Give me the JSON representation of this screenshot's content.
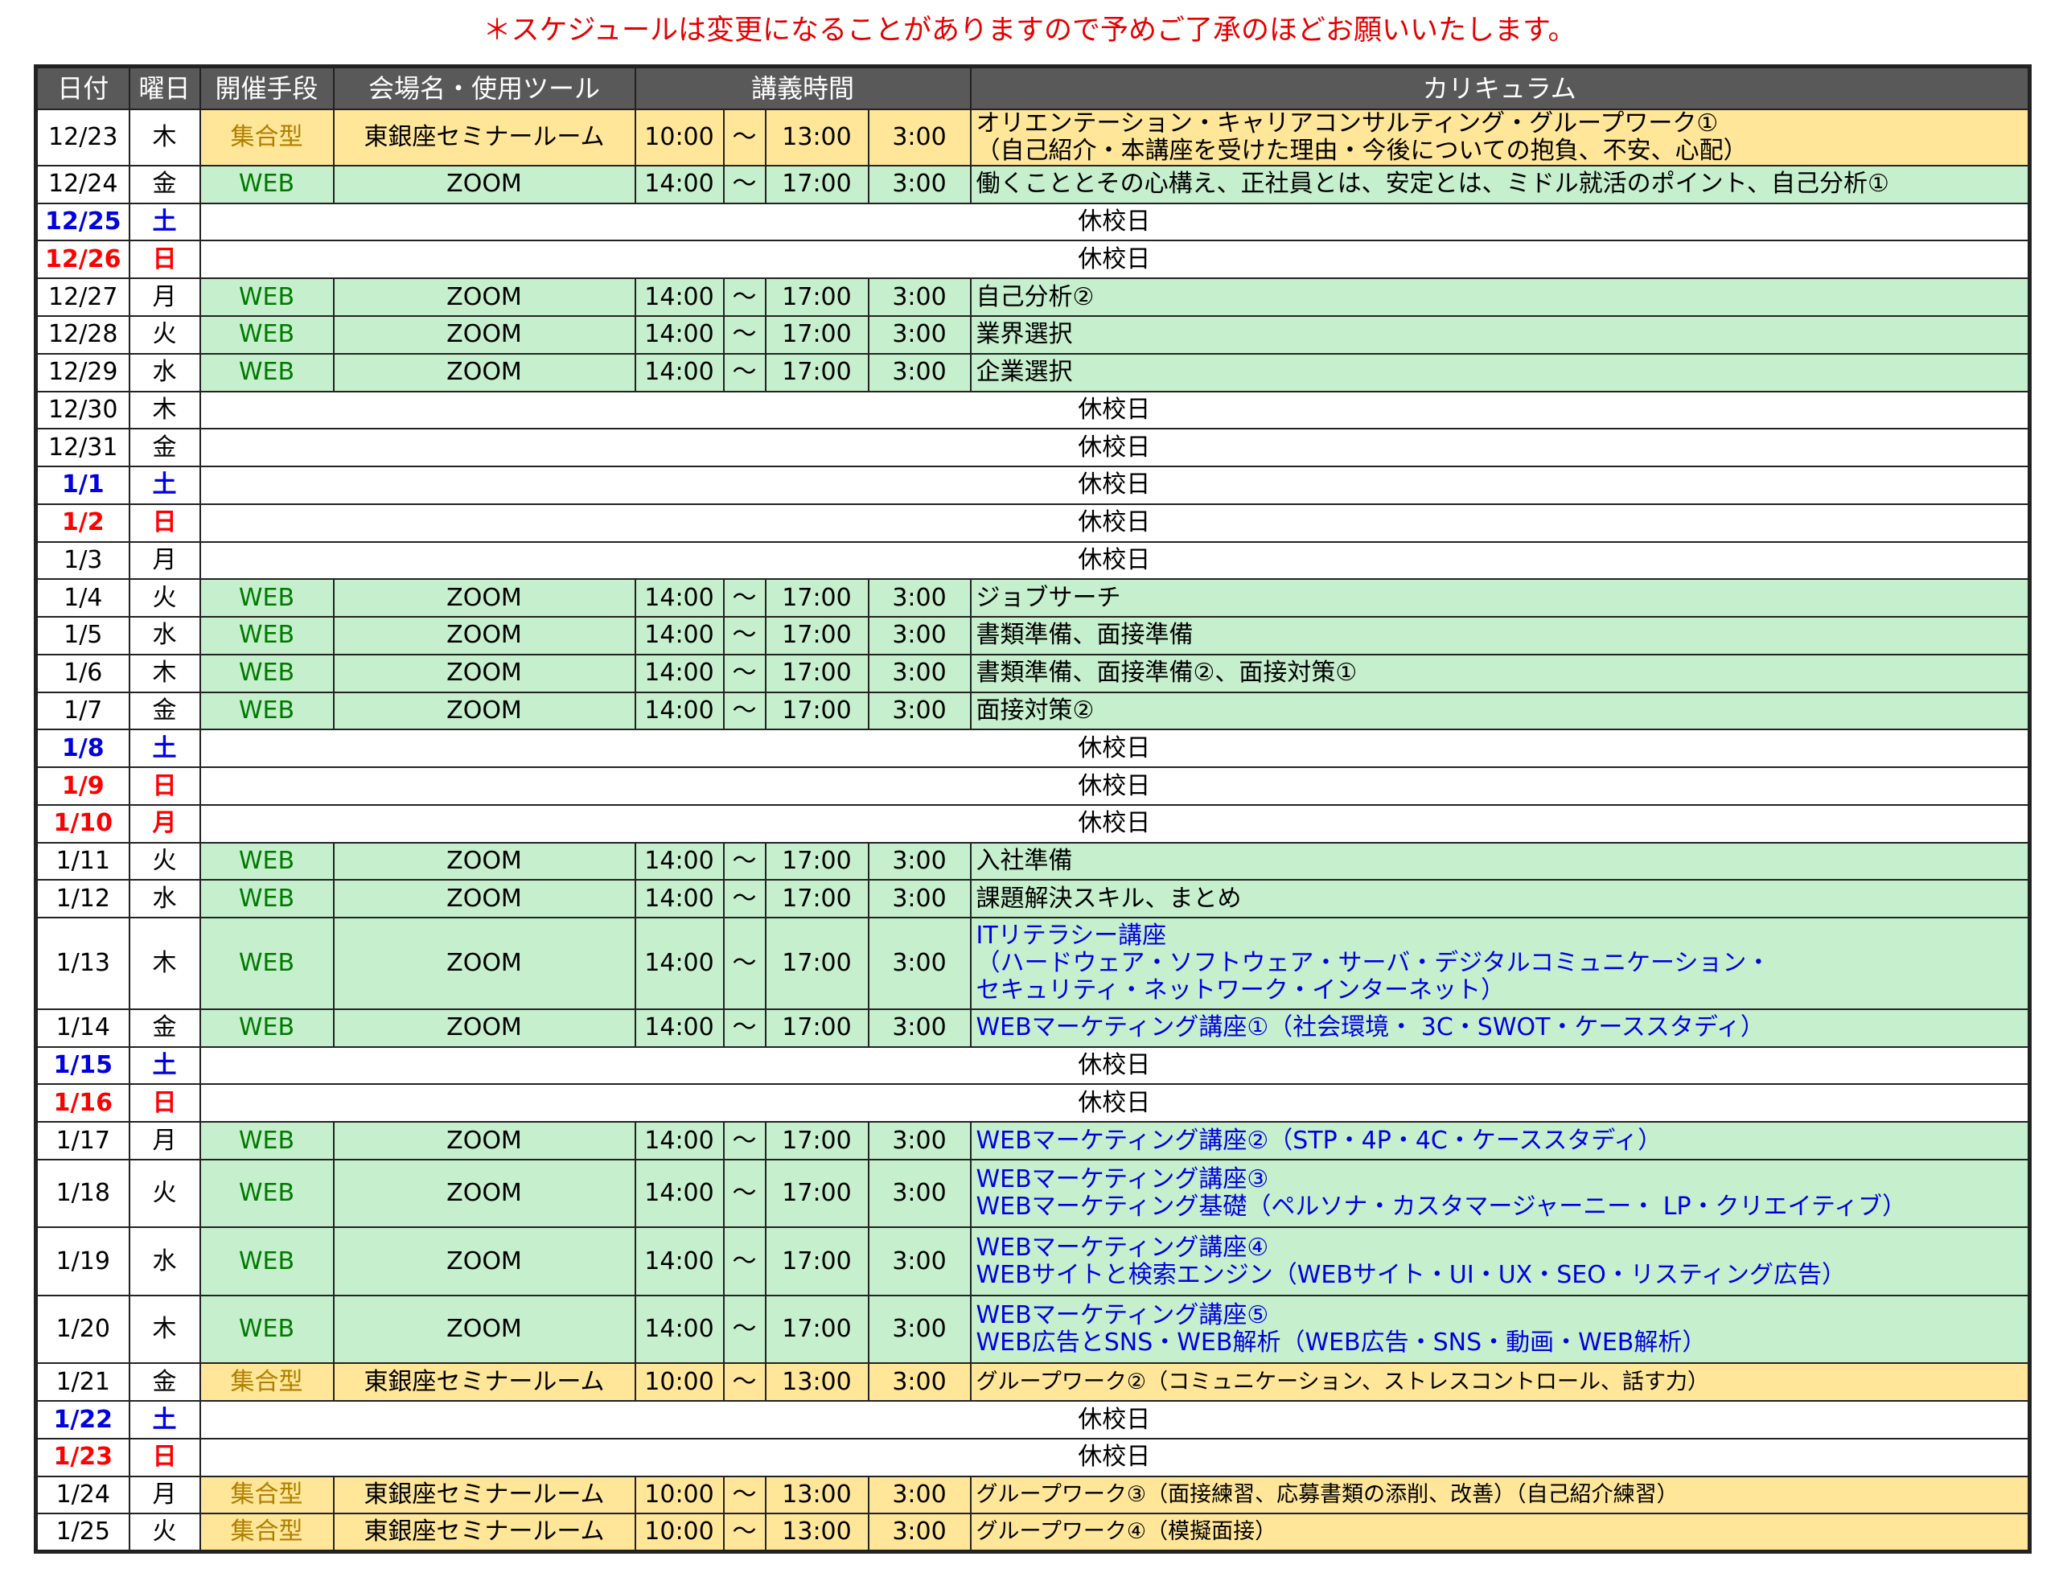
{
  "notice": "＊スケジュールは変更になることがありますので予めご了承のほどお願いいたします。",
  "headers": {
    "date": "日付",
    "day": "曜日",
    "method": "開催手段",
    "venue": "会場名・使用ツール",
    "time": "講義時間",
    "curriculum": "カリキュラム"
  },
  "colors": {
    "header_bg": "#595959",
    "web_row": "#c6efce",
    "group_row": "#ffe699",
    "notice": "#e60000",
    "saturday": "#0000e0",
    "sunday_holiday": "#ff0000"
  },
  "rows": [
    {
      "date": "12/23",
      "day": "木",
      "method": "集合型",
      "venue": "東銀座セミナールーム",
      "start": "10:00",
      "tilde": "～",
      "end": "13:00",
      "dur": "3:00",
      "curriculum": [
        "オリエンテーション・キャリアコンサルティング・グループワーク①",
        "（自己紹介・本講座を受けた理由・今後についての抱負、不安、心配）"
      ]
    },
    {
      "date": "12/24",
      "day": "金",
      "method": "WEB",
      "venue": "ZOOM",
      "start": "14:00",
      "tilde": "～",
      "end": "17:00",
      "dur": "3:00",
      "curriculum": [
        "働くこととその心構え、正社員とは、安定とは、ミドル就活のポイント、自己分析①"
      ]
    },
    {
      "date": "12/25",
      "day": "土",
      "holiday": "休校日"
    },
    {
      "date": "12/26",
      "day": "日",
      "holiday": "休校日"
    },
    {
      "date": "12/27",
      "day": "月",
      "method": "WEB",
      "venue": "ZOOM",
      "start": "14:00",
      "tilde": "～",
      "end": "17:00",
      "dur": "3:00",
      "curriculum": [
        "自己分析②"
      ]
    },
    {
      "date": "12/28",
      "day": "火",
      "method": "WEB",
      "venue": "ZOOM",
      "start": "14:00",
      "tilde": "～",
      "end": "17:00",
      "dur": "3:00",
      "curriculum": [
        "業界選択"
      ]
    },
    {
      "date": "12/29",
      "day": "水",
      "method": "WEB",
      "venue": "ZOOM",
      "start": "14:00",
      "tilde": "～",
      "end": "17:00",
      "dur": "3:00",
      "curriculum": [
        "企業選択"
      ]
    },
    {
      "date": "12/30",
      "day": "木",
      "holiday": "休校日"
    },
    {
      "date": "12/31",
      "day": "金",
      "holiday": "休校日"
    },
    {
      "date": "1/1",
      "day": "土",
      "holiday": "休校日"
    },
    {
      "date": "1/2",
      "day": "日",
      "holiday": "休校日"
    },
    {
      "date": "1/3",
      "day": "月",
      "holiday": "休校日"
    },
    {
      "date": "1/4",
      "day": "火",
      "method": "WEB",
      "venue": "ZOOM",
      "start": "14:00",
      "tilde": "～",
      "end": "17:00",
      "dur": "3:00",
      "curriculum": [
        "ジョブサーチ"
      ]
    },
    {
      "date": "1/5",
      "day": "水",
      "method": "WEB",
      "venue": "ZOOM",
      "start": "14:00",
      "tilde": "～",
      "end": "17:00",
      "dur": "3:00",
      "curriculum": [
        "書類準備、面接準備"
      ]
    },
    {
      "date": "1/6",
      "day": "木",
      "method": "WEB",
      "venue": "ZOOM",
      "start": "14:00",
      "tilde": "～",
      "end": "17:00",
      "dur": "3:00",
      "curriculum": [
        "書類準備、面接準備②、面接対策①"
      ]
    },
    {
      "date": "1/7",
      "day": "金",
      "method": "WEB",
      "venue": "ZOOM",
      "start": "14:00",
      "tilde": "～",
      "end": "17:00",
      "dur": "3:00",
      "curriculum": [
        "面接対策②"
      ]
    },
    {
      "date": "1/8",
      "day": "土",
      "holiday": "休校日"
    },
    {
      "date": "1/9",
      "day": "日",
      "holiday": "休校日"
    },
    {
      "date": "1/10",
      "day": "月",
      "holiday": "休校日"
    },
    {
      "date": "1/11",
      "day": "火",
      "method": "WEB",
      "venue": "ZOOM",
      "start": "14:00",
      "tilde": "～",
      "end": "17:00",
      "dur": "3:00",
      "curriculum": [
        "入社準備"
      ]
    },
    {
      "date": "1/12",
      "day": "水",
      "method": "WEB",
      "venue": "ZOOM",
      "start": "14:00",
      "tilde": "～",
      "end": "17:00",
      "dur": "3:00",
      "curriculum": [
        "課題解決スキル、まとめ"
      ]
    },
    {
      "date": "1/13",
      "day": "木",
      "method": "WEB",
      "venue": "ZOOM",
      "start": "14:00",
      "tilde": "～",
      "end": "17:00",
      "dur": "3:00",
      "curriculum": [
        "ITリテラシー講座",
        "（ハードウェア・ソフトウェア・サーバ・デジタルコミュニケーション・",
        "セキュリティ・ネットワーク・インターネット）"
      ]
    },
    {
      "date": "1/14",
      "day": "金",
      "method": "WEB",
      "venue": "ZOOM",
      "start": "14:00",
      "tilde": "～",
      "end": "17:00",
      "dur": "3:00",
      "curriculum": [
        "WEBマーケティング講座①（社会環境・ 3C・SWOT・ケーススタディ）"
      ]
    },
    {
      "date": "1/15",
      "day": "土",
      "holiday": "休校日"
    },
    {
      "date": "1/16",
      "day": "日",
      "holiday": "休校日"
    },
    {
      "date": "1/17",
      "day": "月",
      "method": "WEB",
      "venue": "ZOOM",
      "start": "14:00",
      "tilde": "～",
      "end": "17:00",
      "dur": "3:00",
      "curriculum": [
        "WEBマーケティング講座②（STP・4P・4C・ケーススタディ）"
      ]
    },
    {
      "date": "1/18",
      "day": "火",
      "method": "WEB",
      "venue": "ZOOM",
      "start": "14:00",
      "tilde": "～",
      "end": "17:00",
      "dur": "3:00",
      "curriculum": [
        "WEBマーケティング講座③",
        "WEBマーケティング基礎（ペルソナ・カスタマージャーニー・ LP・クリエイティブ）"
      ]
    },
    {
      "date": "1/19",
      "day": "水",
      "method": "WEB",
      "venue": "ZOOM",
      "start": "14:00",
      "tilde": "～",
      "end": "17:00",
      "dur": "3:00",
      "curriculum": [
        "WEBマーケティング講座④",
        "WEBサイトと検索エンジン（WEBサイト・UI・UX・SEO・リスティング広告）"
      ]
    },
    {
      "date": "1/20",
      "day": "木",
      "method": "WEB",
      "venue": "ZOOM",
      "start": "14:00",
      "tilde": "～",
      "end": "17:00",
      "dur": "3:00",
      "curriculum": [
        "WEBマーケティング講座⑤",
        "WEB広告とSNS・WEB解析（WEB広告・SNS・動画・WEB解析）"
      ]
    },
    {
      "date": "1/21",
      "day": "金",
      "method": "集合型",
      "venue": "東銀座セミナールーム",
      "start": "10:00",
      "tilde": "～",
      "end": "13:00",
      "dur": "3:00",
      "curriculum": [
        "グループワーク②（コミュニケーション、ストレスコントロール、話す力）"
      ]
    },
    {
      "date": "1/22",
      "day": "土",
      "holiday": "休校日"
    },
    {
      "date": "1/23",
      "day": "日",
      "holiday": "休校日"
    },
    {
      "date": "1/24",
      "day": "月",
      "method": "集合型",
      "venue": "東銀座セミナールーム",
      "start": "10:00",
      "tilde": "～",
      "end": "13:00",
      "dur": "3:00",
      "curriculum": [
        "グループワーク③（面接練習、応募書類の添削、改善）（自己紹介練習）"
      ]
    },
    {
      "date": "1/25",
      "day": "火",
      "method": "集合型",
      "venue": "東銀座セミナールーム",
      "start": "10:00",
      "tilde": "～",
      "end": "13:00",
      "dur": "3:00",
      "curriculum": [
        "グループワーク④（模擬面接）"
      ]
    }
  ]
}
